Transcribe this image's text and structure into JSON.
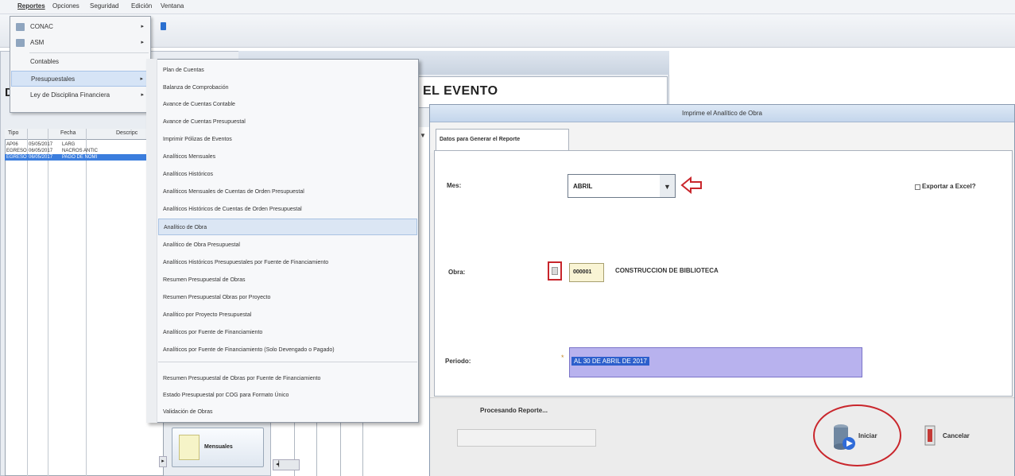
{
  "menubar": {
    "items": [
      "Reportes",
      "Opciones",
      "Seguridad",
      "Edición",
      "Ventana"
    ]
  },
  "background": {
    "heading": "EL EVENTO",
    "left_letter": "D",
    "grid": {
      "headers": [
        "Tipo",
        "Fecha",
        "Descripc"
      ],
      "rows": [
        [
          "AP06",
          "05/05/2017",
          "LARG"
        ],
        [
          "EGRESO",
          "06/05/2017",
          "NACROS ANTIC"
        ],
        [
          "EGRESO",
          "06/05/2017",
          "PAGO DE NOMI"
        ]
      ]
    },
    "mensuales_label": "Mensuales"
  },
  "menu1": {
    "items": [
      {
        "label": "CONAC",
        "submenu": true
      },
      {
        "label": "ASM",
        "submenu": true
      },
      {
        "label": "Contables",
        "submenu": false
      },
      {
        "label": "Presupuestales",
        "submenu": true
      },
      {
        "label": "Ley de Disciplina Financiera",
        "submenu": true
      }
    ]
  },
  "menu2": {
    "items": [
      "Plan de Cuentas",
      "Balanza de Comprobación",
      "Avance de Cuentas Contable",
      "Avance de Cuentas Presupuestal",
      "Imprimir Pólizas de Eventos",
      "Analíticos Mensuales",
      "Analíticos Históricos",
      "Analíticos Mensuales de Cuentas de Orden Presupuestal",
      "Analíticos Históricos de Cuentas de Orden Presupuestal",
      "Analítico de Obra",
      "Analítico de Obra Presupuestal",
      "Analíticos Históricos Presupuestales por Fuente de Financiamiento",
      "Resumen Presupuestal de Obras",
      "Resumen Presupuestal Obras por Proyecto",
      "Analítico por Proyecto Presupuestal",
      "Analíticos por Fuente de Financiamiento",
      "Analíticos por Fuente de Financiamiento (Solo Devengado o Pagado)",
      "Resumen Presupuestal de Obras por Fuente de Financiamiento",
      "Estado Presupuestal por COG para Formato Único",
      "Validación de Obras"
    ],
    "highlighted_index": 9
  },
  "dialog": {
    "title": "Imprime el Analítico de Obra",
    "tab_label": "Datos para Generar el Reporte",
    "mes_label": "Mes:",
    "mes_value": "ABRIL",
    "excel_label": "Exportar a Excel?",
    "obra_label": "Obra:",
    "obra_code": "000001",
    "obra_name": "CONSTRUCCION DE BIBLIOTECA",
    "periodo_label": "Periodo:",
    "periodo_value": "AL 30 DE ABRIL DE 2017",
    "procesando_label": "Procesando Reporte...",
    "iniciar_label": "Iniciar",
    "cancelar_label": "Cancelar"
  },
  "colors": {
    "highlight_red": "#c9262c",
    "selection_blue": "#2d5fcc",
    "periodo_bg": "#b8b2ee"
  }
}
